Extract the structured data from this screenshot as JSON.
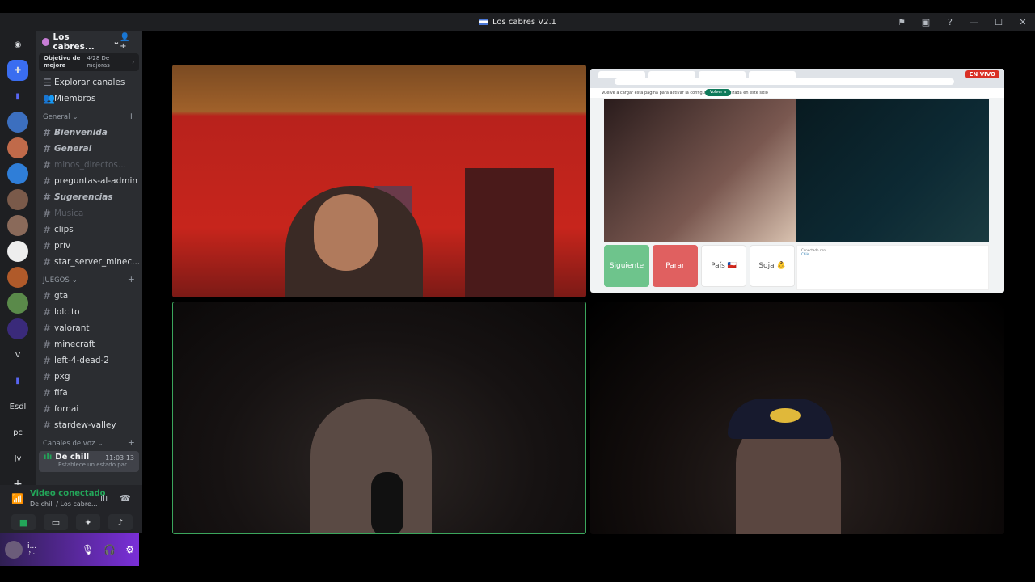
{
  "window": {
    "title": "Los cabres V2.1"
  },
  "rail": {
    "items": [
      "",
      "",
      "",
      "",
      "",
      "",
      "",
      "",
      "",
      "",
      "",
      "V",
      "",
      "Esdl",
      "pc",
      "Jv",
      "+"
    ]
  },
  "server": {
    "name": "Los cabres...",
    "boost_goal": "Objetivo de mejora",
    "boost_count": "4/28 De mejoras",
    "explore": "Explorar canales",
    "members": "Miembros",
    "general_cat": "General",
    "juegos_cat": "JUEGOS",
    "voice_cat": "Canales de voz",
    "channels_general": [
      {
        "name": "Bienvenida",
        "style": "it"
      },
      {
        "name": "General",
        "style": "it"
      },
      {
        "name": "minos_directos...",
        "style": "dim"
      },
      {
        "name": "preguntas-al-admin",
        "style": "bright"
      },
      {
        "name": "Sugerencias",
        "style": "it"
      },
      {
        "name": "Musica",
        "style": "dim"
      },
      {
        "name": "clips",
        "style": "bright"
      },
      {
        "name": "priv",
        "style": "bright"
      },
      {
        "name": "star_server_minec...",
        "style": "bright"
      }
    ],
    "channels_juegos": [
      "gta",
      "lolcito",
      "valorant",
      "minecraft",
      "left-4-dead-2",
      "pxg",
      "fifa",
      "fornai",
      "stardew-valley"
    ],
    "voice_channel": {
      "name": "De chill",
      "time": "11:03:13",
      "status": "Establece un estado par..."
    }
  },
  "voice_panel": {
    "status": "Video conectado",
    "location": "De chill / Los cabre..."
  },
  "user_panel": {
    "name": "i...",
    "status": "♪ ·..."
  },
  "stream": {
    "live_badge": "EN VIVO",
    "tabs": [
      "",
      "",
      "",
      ""
    ],
    "banner_text": "Vuelve a cargar esta pagina para activar la configuracion actualizada en este sitio",
    "banner_button": "Volver a cargar",
    "buttons": {
      "next": "Siguiente",
      "stop": "Parar",
      "country": "País 🇨🇱",
      "gender": "Soja 👶"
    },
    "chat_lines": [
      "Conectado con...",
      "Chile"
    ]
  },
  "colors": {
    "accent": "#5865f2",
    "connected": "#23a559",
    "speaking_border": "#3ba55c",
    "next": "#6ec48c",
    "stop": "#e06060",
    "live": "#d93025"
  }
}
